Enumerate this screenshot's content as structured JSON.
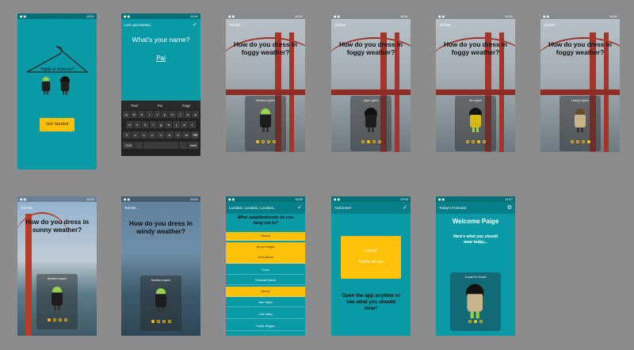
{
  "status_bar": {
    "icons_left": "◼ ▣",
    "icons_right": "✱ ▼ ▮"
  },
  "screens": {
    "s1": {
      "time": "10:51",
      "hanger_text": "Tights or Scarves?",
      "button": "Get Started"
    },
    "s2": {
      "time": "10:51",
      "title": "Let's get started...",
      "prompt": "What's your name?",
      "name_value": "Pai",
      "suggestions": [
        "Paid",
        "Pai",
        "Paige"
      ],
      "kb_row1": [
        "q",
        "w",
        "e",
        "r",
        "t",
        "y",
        "u",
        "i",
        "o",
        "p"
      ],
      "kb_row2": [
        "a",
        "s",
        "d",
        "f",
        "g",
        "h",
        "j",
        "k",
        "l"
      ],
      "kb_row3": [
        "⇧",
        "z",
        "x",
        "c",
        "v",
        "b",
        "n",
        "m",
        "⌫"
      ],
      "kb_row4": [
        "?123",
        ",",
        "",
        ".",
        "Next"
      ]
    },
    "s3": {
      "time": "10:51",
      "title": "Tell Me...",
      "question": "How do you dress in foggy weather?",
      "card_label": "Medium Layers",
      "selected": 0
    },
    "s4": {
      "time": "10:51",
      "title": "Tell Me...",
      "question": "How do you dress in foggy weather?",
      "card_label": "Light Layers",
      "selected": 1
    },
    "s5": {
      "time": "10:51",
      "title": "Tell Me...",
      "question": "How do you dress in foggy weather?",
      "card_label": "No Layers",
      "selected": 2
    },
    "s6": {
      "time": "10:51",
      "title": "Tell Me...",
      "question": "How do you dress in foggy weather?",
      "card_label": "Heavy Layers",
      "selected": 3
    },
    "s7": {
      "time": "10:51",
      "title": "Tell Me...",
      "question": "How do you dress in sunny weather?",
      "card_label": "Medium Layers",
      "selected": 0
    },
    "s8": {
      "time": "10:51",
      "title": "Tell Me...",
      "question": "How do you dress in windy weather?",
      "card_label": "Medium Layers",
      "selected": 0
    },
    "s9": {
      "time": "10:53",
      "title": "Location, Location, Location...",
      "question": "What neighborhoods do you hang out in?",
      "items": [
        {
          "label": "Mission",
          "sel": true
        },
        {
          "label": "Bernal Heights",
          "sel": true
        },
        {
          "label": "North Beach",
          "sel": true
        },
        {
          "label": "Soma",
          "sel": false
        },
        {
          "label": "Financial District",
          "sel": false
        },
        {
          "label": "Marina",
          "sel": true
        },
        {
          "label": "Noe Valley",
          "sel": false
        },
        {
          "label": "Cole Valley",
          "sel": false
        },
        {
          "label": "Pacific Heights",
          "sel": false
        }
      ]
    },
    "s10": {
      "time": "10:53",
      "title": "And Done!",
      "box_line1": "Lovely!",
      "box_line2": "You're all set.",
      "message": "Open the app anytime to see what you should wear!"
    },
    "s11": {
      "time": "11:57",
      "title": "Today's Forecast",
      "welcome": "Welcome Paige",
      "subtitle": "Here's what you should wear today...",
      "card_label": "A scarf for Soma!",
      "selected": 1
    }
  },
  "colors": {
    "teal": "#0a9aa6",
    "teal_dark": "#067f89",
    "accent": "#ffc107"
  }
}
